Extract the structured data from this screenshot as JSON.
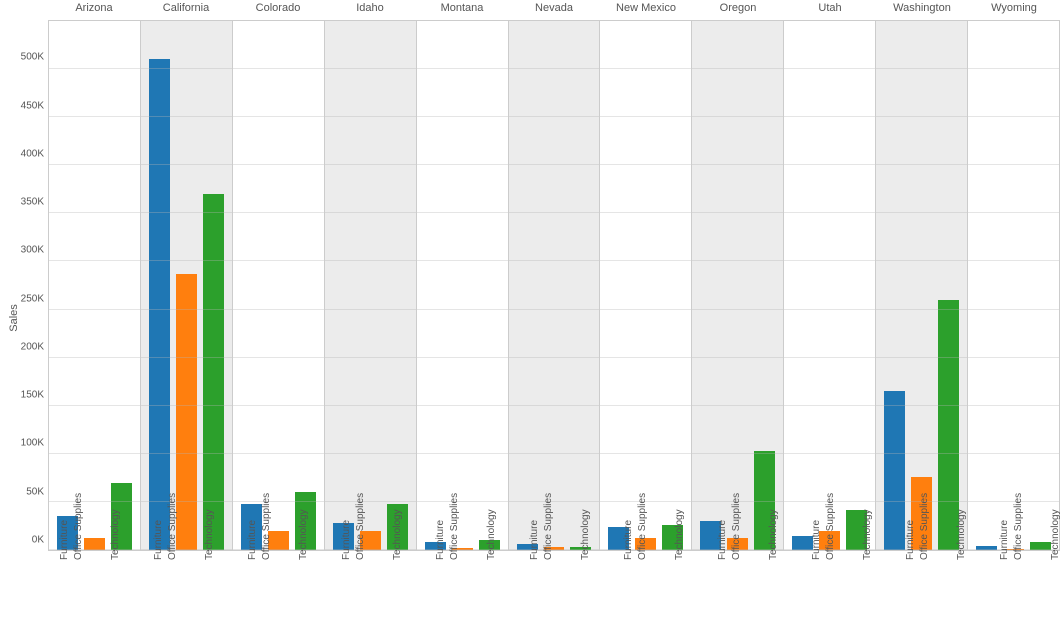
{
  "chart_data": {
    "type": "bar",
    "ylabel": "Sales",
    "ylim": [
      0,
      550000
    ],
    "y_ticks": [
      0,
      50000,
      100000,
      150000,
      200000,
      250000,
      300000,
      350000,
      400000,
      450000,
      500000
    ],
    "y_tick_labels": [
      "0K",
      "50K",
      "100K",
      "150K",
      "200K",
      "250K",
      "300K",
      "350K",
      "400K",
      "450K",
      "500K"
    ],
    "facets": [
      "Arizona",
      "California",
      "Colorado",
      "Idaho",
      "Montana",
      "Nevada",
      "New Mexico",
      "Oregon",
      "Utah",
      "Washington",
      "Wyoming"
    ],
    "categories": [
      "Furniture",
      "Office Supplies",
      "Technology"
    ],
    "colors": {
      "Furniture": "#1f77b4",
      "Office Supplies": "#ff7f0e",
      "Technology": "#2ca02c"
    },
    "series": [
      {
        "name": "Arizona",
        "values": [
          35000,
          12000,
          70000
        ]
      },
      {
        "name": "California",
        "values": [
          510000,
          287000,
          370000
        ]
      },
      {
        "name": "Colorado",
        "values": [
          48000,
          20000,
          60000
        ]
      },
      {
        "name": "Idaho",
        "values": [
          28000,
          20000,
          48000
        ]
      },
      {
        "name": "Montana",
        "values": [
          8000,
          2000,
          10000
        ]
      },
      {
        "name": "Nevada",
        "values": [
          6000,
          3000,
          3000
        ]
      },
      {
        "name": "New Mexico",
        "values": [
          24000,
          12000,
          26000
        ]
      },
      {
        "name": "Oregon",
        "values": [
          30000,
          12000,
          103000
        ]
      },
      {
        "name": "Utah",
        "values": [
          15000,
          20000,
          42000
        ]
      },
      {
        "name": "Washington",
        "values": [
          165000,
          76000,
          260000
        ]
      },
      {
        "name": "Wyoming",
        "values": [
          4000,
          1500,
          8000
        ]
      }
    ]
  }
}
